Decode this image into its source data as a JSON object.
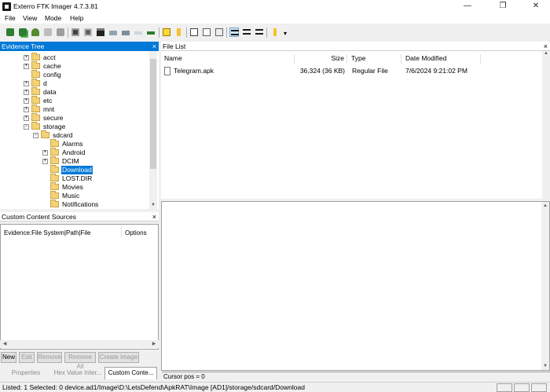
{
  "window": {
    "title": "Exterro FTK Imager 4.7.3.81",
    "minimize": "—",
    "restore": "❐",
    "close": "✕"
  },
  "menu": [
    "File",
    "View",
    "Mode",
    "Help"
  ],
  "toolbar": {
    "icons": [
      "add-evidence-icon",
      "add-all-attached-icon",
      "image-mounting-icon",
      "remove-evidence-icon",
      "remove-all-evidence-icon",
      "create-disk-image-icon",
      "export-disk-image-icon",
      "export-logical-image-icon",
      "add-to-custom-content-icon",
      "create-custom-content-image-icon",
      "decrypt-ad1-icon",
      "verify-drive-icon",
      "capture-memory-icon",
      "obtain-protected-files-icon",
      "detect-efs-icon",
      "export-files-icon",
      "export-file-hash-list-icon",
      "export-directory-listing-icon",
      "auto-view-icon",
      "text-view-icon",
      "hex-view-icon",
      "help-icon"
    ],
    "overflow": "▾"
  },
  "evidence_tree": {
    "title": "Evidence Tree",
    "nodes": [
      {
        "label": "acct",
        "expander": "+"
      },
      {
        "label": "cache",
        "expander": "+"
      },
      {
        "label": "config",
        "expander": ""
      },
      {
        "label": "d",
        "expander": "+"
      },
      {
        "label": "data",
        "expander": "+"
      },
      {
        "label": "etc",
        "expander": "+"
      },
      {
        "label": "mnt",
        "expander": "+"
      },
      {
        "label": "secure",
        "expander": "+"
      },
      {
        "label": "storage",
        "expander": "−"
      },
      {
        "label": "sdcard",
        "expander": "−"
      },
      {
        "label": "Alarms",
        "expander": ""
      },
      {
        "label": "Android",
        "expander": "+"
      },
      {
        "label": "DCIM",
        "expander": "+"
      },
      {
        "label": "Download",
        "expander": "",
        "selected": true
      },
      {
        "label": "LOST.DIR",
        "expander": ""
      },
      {
        "label": "Movies",
        "expander": ""
      },
      {
        "label": "Music",
        "expander": ""
      },
      {
        "label": "Notifications",
        "expander": ""
      }
    ]
  },
  "file_list": {
    "title": "File List",
    "columns": [
      "Name",
      "Size",
      "Type",
      "Date Modified"
    ],
    "rows": [
      {
        "name": "Telegram.apk",
        "size": "36,324 (36 KB)",
        "type": "Regular File",
        "date_modified": "7/6/2024 9:21:02 PM"
      }
    ]
  },
  "custom_content": {
    "title": "Custom Content Sources",
    "columns": [
      "Evidence:File System|Path|File",
      "Options"
    ],
    "buttons": [
      "New",
      "Edit",
      "Remove",
      "Remove All",
      "Create Image"
    ]
  },
  "tabs": [
    "Properties",
    "Hex Value Inter...",
    "Custom Conte..."
  ],
  "cursor_pos": "Cursor pos = 0",
  "status": "Listed: 1   Selected: 0   device.ad1/Image\\D:\\LetsDefend\\ApkRAT\\Image [AD1]/storage/sdcard/Download",
  "close_glyph": "×",
  "arrows": {
    "up": "▲",
    "down": "▼",
    "left": "◀",
    "right": "▶"
  },
  "colors": {
    "accent": "#0078d7",
    "folder": "#f3d27a"
  }
}
